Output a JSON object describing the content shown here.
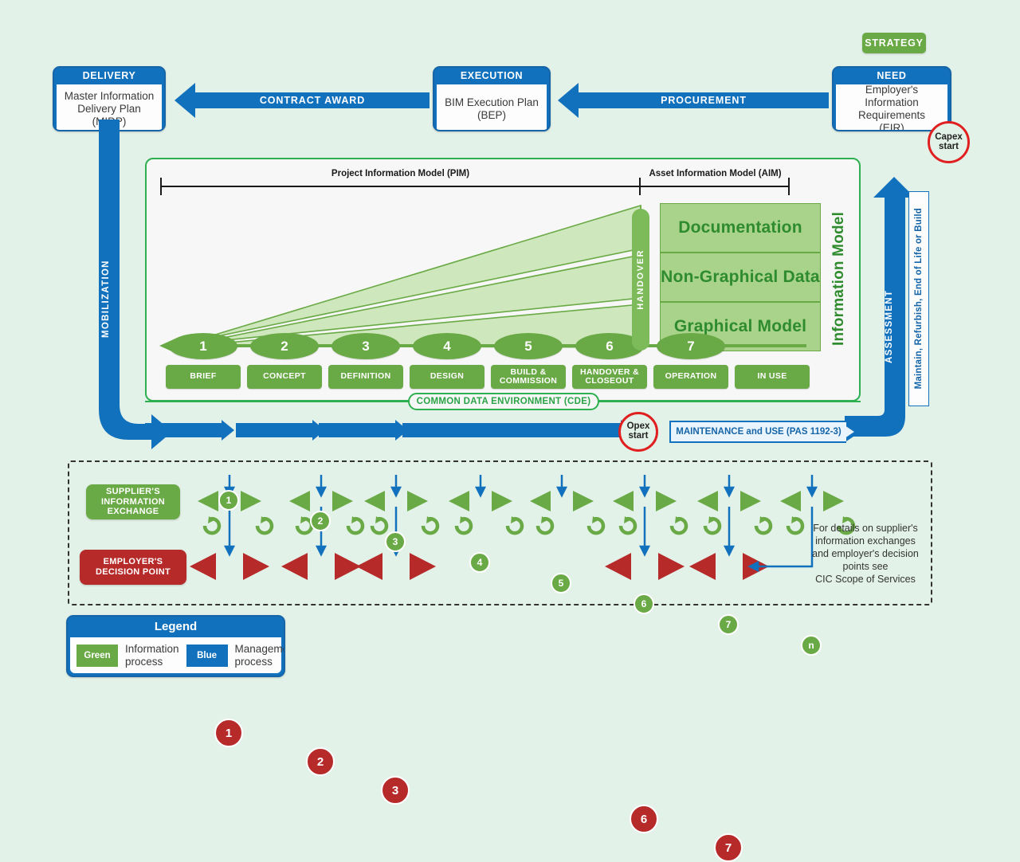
{
  "top_row": {
    "strategy": {
      "label": "STRATEGY"
    },
    "cards": [
      {
        "head": "DELIVERY",
        "lines": [
          "Master Information",
          "Delivery Plan",
          "(MIDP)"
        ]
      },
      {
        "head": "EXECUTION",
        "lines": [
          "BIM Execution Plan",
          "(BEP)"
        ]
      },
      {
        "head": "NEED",
        "lines": [
          "Employer's Information",
          "Requirements",
          "(EIR)"
        ]
      }
    ],
    "arrows": [
      {
        "label": "CONTRACT AWARD"
      },
      {
        "label": "PROCUREMENT"
      }
    ],
    "capex": {
      "line1": "Capex",
      "line2": "start"
    }
  },
  "side_labels": {
    "mobilization": "MOBILIZATION",
    "assessment": "ASSESSMENT",
    "maintain": "Maintain, Refurbish, End of Life or Build"
  },
  "green_panel": {
    "pim_label": "Project Information Model (PIM)",
    "aim_label": "Asset Information Model (AIM)",
    "handover": "HANDOVER",
    "information_model": "Information Model",
    "aim_blocks": [
      "Documentation",
      "Non-Graphical Data",
      "Graphical Model"
    ],
    "cde": "COMMON DATA ENVIRONMENT (CDE)",
    "stages": [
      {
        "num": "1",
        "label": "BRIEF"
      },
      {
        "num": "2",
        "label": "CONCEPT"
      },
      {
        "num": "3",
        "label": "DEFINITION"
      },
      {
        "num": "4",
        "label": "DESIGN"
      },
      {
        "num": "5",
        "label": "BUILD &\nCOMMISSION"
      },
      {
        "num": "6",
        "label": "HANDOVER &\nCLOSEOUT"
      },
      {
        "num": "7",
        "label": "OPERATION"
      },
      {
        "num": "",
        "label": "IN USE"
      }
    ]
  },
  "mid_row": {
    "opex": {
      "line1": "Opex",
      "line2": "start"
    },
    "maintenance": "MAINTENANCE and USE (PAS 1192-3)"
  },
  "bottom_panel": {
    "supplier_tag": "SUPPLIER'S\nINFORMATION\nEXCHANGE",
    "employer_tag": "EMPLOYER'S\nDECISION POINT",
    "supplier_nodes": [
      "1",
      "2",
      "3",
      "4",
      "5",
      "6",
      "7",
      "n"
    ],
    "employer_nodes": [
      "1",
      "2",
      "3",
      "",
      "",
      "6",
      "7",
      ""
    ],
    "note": [
      "For details on supplier's",
      "information exchanges",
      "and employer's decision",
      "points see",
      "CIC Scope of Services"
    ]
  },
  "legend": {
    "title": "Legend",
    "items": [
      {
        "swatch": "Green",
        "l1": "Information",
        "l2": "process"
      },
      {
        "swatch": "Blue",
        "l1": "Management",
        "l2": "process"
      }
    ]
  },
  "colors": {
    "blue": "#1271bd",
    "blue_dark": "#1565a8",
    "green": "#6aaa46",
    "green_bright": "#2eb050",
    "green_text": "#2e8b2e",
    "green_fill": "#a9d38b",
    "red": "#b62a2a",
    "red_outline": "#e02020",
    "bg": "#e3f2e8"
  }
}
